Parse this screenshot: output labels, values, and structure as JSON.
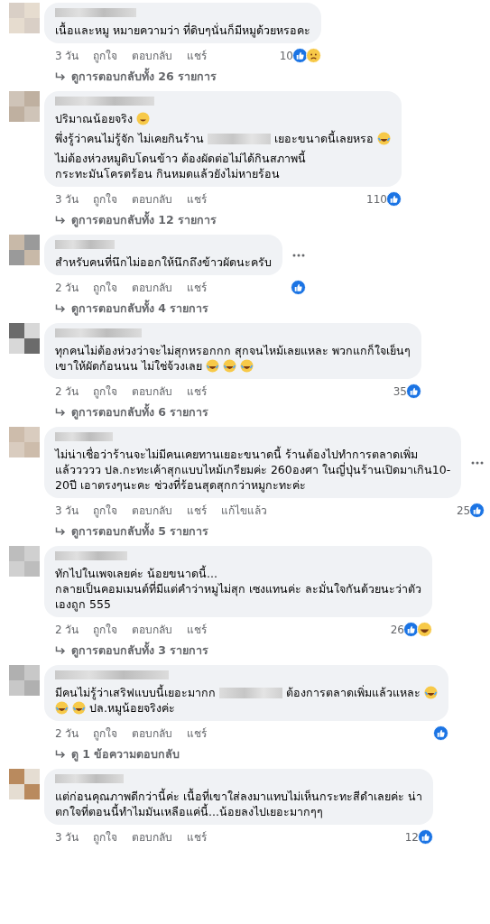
{
  "comments": [
    {
      "paragraphs": [
        [
          [
            {
              "kind": "text",
              "text": "เนื้อและหมู หมายความว่า ที่ดิบๆนั่นก็มีหมูด้วยหรอคะ"
            }
          ]
        ]
      ],
      "more": false,
      "time": "3 วัน",
      "actions": [
        "ถูกใจ",
        "ตอบกลับ",
        "แชร์"
      ],
      "reaction_count": "10",
      "reactions": [
        {
          "kind": "like"
        },
        {
          "kind": "sad"
        }
      ],
      "replies": "ดูการตอบกลับทั้ง 26 รายการ"
    },
    {
      "paragraphs": [
        [
          [
            {
              "kind": "text",
              "text": "ปริมาณน้อยจริง"
            },
            {
              "kind": "smile-emoji"
            }
          ]
        ],
        [
          [
            {
              "kind": "text",
              "text": "พึ่งรู้ว่าคนไม่รู้จัก ไม่เคยกินร้าน"
            },
            {
              "kind": "blur"
            },
            {
              "kind": "text",
              "text": "เยอะขนาดนี้เลยหรอ"
            },
            {
              "kind": "laugh-emoji"
            }
          ]
        ],
        [
          [
            {
              "kind": "text",
              "text": "ไม่ต้องห่วงหมูดิบโดนข้าว ต้องผัดต่อไม่ได้กินสภาพนี้"
            }
          ],
          [
            {
              "kind": "text",
              "text": "กระทะมันโครตร้อน กินหมดแล้วยังไม่หายร้อน"
            }
          ]
        ]
      ],
      "more": false,
      "time": "3 วัน",
      "actions": [
        "ถูกใจ",
        "ตอบกลับ",
        "แชร์"
      ],
      "reaction_count": "110",
      "reactions": [
        {
          "kind": "like"
        }
      ],
      "replies": "ดูการตอบกลับทั้ง 12 รายการ"
    },
    {
      "paragraphs": [
        [
          [
            {
              "kind": "text",
              "text": "สำหรับคนที่นึกไม่ออกให้นึกถึงข้าวผัดนะครับ"
            }
          ]
        ]
      ],
      "more": true,
      "time": "2 วัน",
      "actions": [
        "ถูกใจ",
        "ตอบกลับ",
        "แชร์"
      ],
      "reactions": [
        {
          "kind": "like"
        }
      ],
      "replies": "ดูการตอบกลับทั้ง 4 รายการ"
    },
    {
      "paragraphs": [
        [
          [
            {
              "kind": "text",
              "text": "ทุกคนไม่ต้องห่วงว่าจะไม่สุกหรอกกก สุกจนไหม้เลยแหละ พวกแกก็ใจเย็นๆ"
            }
          ],
          [
            {
              "kind": "text",
              "text": "เขาให้ผัดก้อนนน ไม่ใช่จ้วงเลย"
            },
            {
              "kind": "laugh-emoji"
            },
            {
              "kind": "laugh-emoji"
            },
            {
              "kind": "laugh-emoji"
            }
          ]
        ]
      ],
      "more": false,
      "time": "2 วัน",
      "actions": [
        "ถูกใจ",
        "ตอบกลับ",
        "แชร์"
      ],
      "reaction_count": "35",
      "reactions": [
        {
          "kind": "like"
        }
      ],
      "replies": "ดูการตอบกลับทั้ง 6 รายการ"
    },
    {
      "paragraphs": [
        [
          [
            {
              "kind": "text",
              "text": "ไม่น่าเชื่อว่าร้านจะไม่มีคนเคยทานเยอะขนาดนี้ ร้านต้องไปทำการตลาดเพิ่ม"
            }
          ],
          [
            {
              "kind": "text",
              "text": "แล้ววววว ปล.กะทะเค้าสุกแบบไหม้เกรียมค่ะ 260องศา ในญี่ปุ่นร้านเปิดมาเกิน10-"
            }
          ],
          [
            {
              "kind": "text",
              "text": "20ปี เอาตรงๆนะคะ ช่วงที่ร้อนสุดสุกกว่าหมูกะทะค่ะ"
            }
          ]
        ]
      ],
      "more": true,
      "time": "3 วัน",
      "actions": [
        "ถูกใจ",
        "ตอบกลับ",
        "แชร์",
        "แก้ไขแล้ว"
      ],
      "reaction_count": "25",
      "reactions": [
        {
          "kind": "like"
        }
      ],
      "replies": "ดูการตอบกลับทั้ง 5 รายการ"
    },
    {
      "paragraphs": [
        [
          [
            {
              "kind": "text",
              "text": "ทักไปในเพจเลยค่ะ น้อยขนาดนี้..."
            }
          ],
          [
            {
              "kind": "text",
              "text": "กลายเป็นคอมเมนต์ที่มีแต่คำว่าหมูไม่สุก เซงแทนค่ะ ละมั่นใจกันด้วยนะว่าตัว"
            }
          ],
          [
            {
              "kind": "text",
              "text": "เองถูก 555"
            }
          ]
        ]
      ],
      "more": false,
      "time": "2 วัน",
      "actions": [
        "ถูกใจ",
        "ตอบกลับ",
        "แชร์"
      ],
      "reaction_count": "26",
      "reactions": [
        {
          "kind": "like"
        },
        {
          "kind": "haha"
        }
      ],
      "replies": "ดูการตอบกลับทั้ง 3 รายการ"
    },
    {
      "paragraphs": [
        [
          [
            {
              "kind": "text",
              "text": "มีคนไม่รู้ว่าเสริฟแบบนี้เยอะมากก"
            },
            {
              "kind": "blur"
            },
            {
              "kind": "text",
              "text": "ต้องการตลาดเพิ่มแล้วแหละ"
            },
            {
              "kind": "laugh-emoji"
            }
          ],
          [
            {
              "kind": "laugh-emoji"
            },
            {
              "kind": "laugh-emoji"
            },
            {
              "kind": "text",
              "text": "ปล.หมูน้อยจริงค่ะ"
            }
          ]
        ]
      ],
      "more": false,
      "time": "2 วัน",
      "actions": [
        "ถูกใจ",
        "ตอบกลับ",
        "แชร์"
      ],
      "reactions": [
        {
          "kind": "like"
        }
      ],
      "replies": "ดู 1 ข้อความตอบกลับ"
    },
    {
      "paragraphs": [
        [
          [
            {
              "kind": "text",
              "text": "แต่ก่อนคุณภาพดีกว่านี้ค่ะ เนื้อที่เขาใส่ลงมาแทบไม่เห็นกระทะสีดำเลยค่ะ น่า"
            }
          ],
          [
            {
              "kind": "text",
              "text": "ตกใจที่ตอนนี้ทำไมมันเหลือแค่นี้...น้อยลงไปเยอะมากๆๆ"
            }
          ]
        ]
      ],
      "more": false,
      "time": "3 วัน",
      "actions": [
        "ถูกใจ",
        "ตอบกลับ",
        "แชร์"
      ],
      "reaction_count": "12",
      "reactions": [
        {
          "kind": "like"
        }
      ]
    }
  ]
}
